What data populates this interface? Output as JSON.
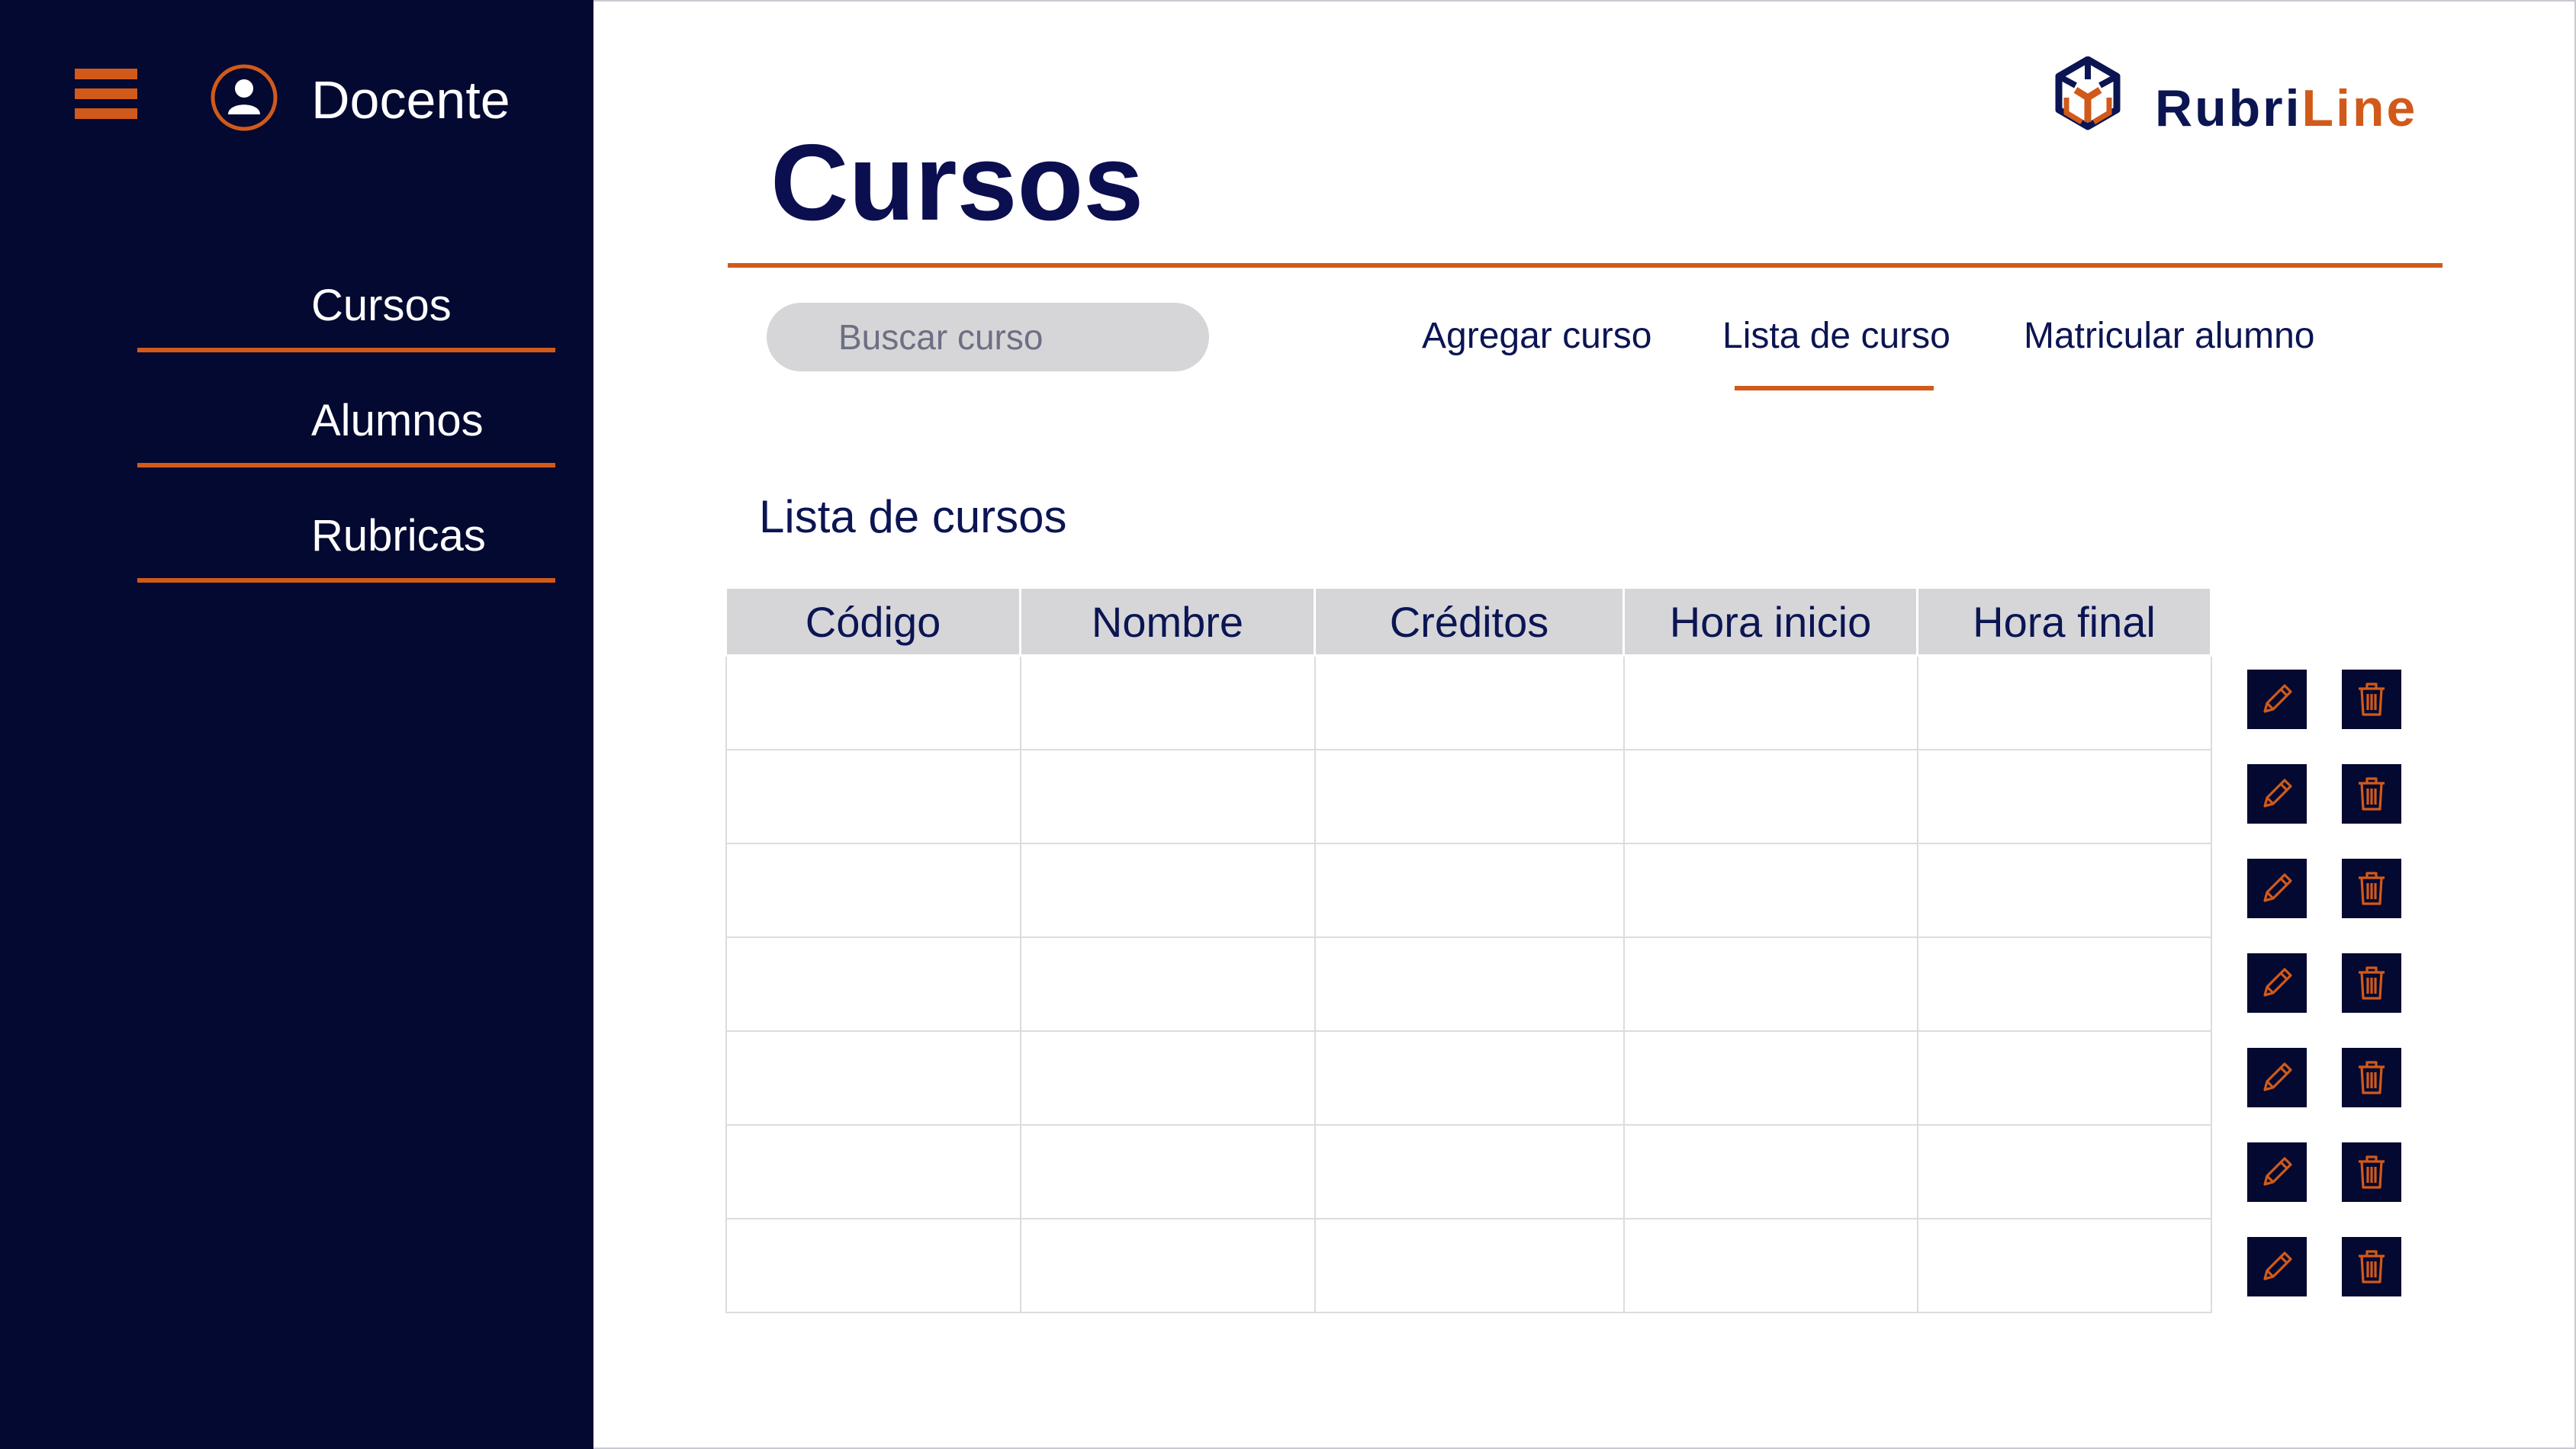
{
  "theme": {
    "sidebar_bg": "#040931",
    "accent": "#d15a1a",
    "text_dark": "#0b1552",
    "header_cell_bg": "#d6d6d9"
  },
  "sidebar": {
    "menu_icon": "hamburger-menu-icon",
    "user_icon": "user-circle-icon",
    "role": "Docente",
    "items": [
      {
        "label": "Cursos"
      },
      {
        "label": "Alumnos"
      },
      {
        "label": "Rubricas"
      }
    ]
  },
  "brand": {
    "logo_icon": "cube-logo-icon",
    "name_part1": "Rubri",
    "name_part2": "Line"
  },
  "page": {
    "title": "Cursos"
  },
  "search": {
    "placeholder": "Buscar curso",
    "value": ""
  },
  "tabs": [
    {
      "label": "Agregar curso",
      "active": false
    },
    {
      "label": "Lista de curso",
      "active": true
    },
    {
      "label": "Matricular alumno",
      "active": false
    }
  ],
  "section": {
    "title": "Lista de cursos"
  },
  "table": {
    "columns": [
      "Código",
      "Nombre",
      "Créditos",
      "Hora inicio",
      "Hora final"
    ],
    "rows": [
      [
        "",
        "",
        "",
        "",
        ""
      ],
      [
        "",
        "",
        "",
        "",
        ""
      ],
      [
        "",
        "",
        "",
        "",
        ""
      ],
      [
        "",
        "",
        "",
        "",
        ""
      ],
      [
        "",
        "",
        "",
        "",
        ""
      ],
      [
        "",
        "",
        "",
        "",
        ""
      ],
      [
        "",
        "",
        "",
        "",
        ""
      ]
    ]
  },
  "row_actions": {
    "edit_icon": "pencil-icon",
    "delete_icon": "trash-icon"
  }
}
